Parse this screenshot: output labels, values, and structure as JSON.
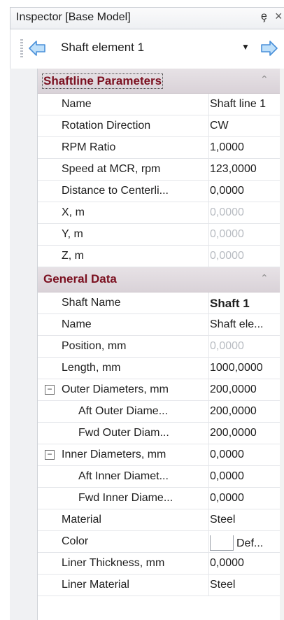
{
  "window": {
    "title": "Inspector [Base Model]",
    "pin_glyph": "ȩ",
    "close_glyph": "×"
  },
  "selector": {
    "label": "Shaft element 1",
    "arrow_glyph": "▼"
  },
  "icons": {
    "nav_left": "arrow-left-icon",
    "nav_right": "arrow-right-icon",
    "accent": "#5aa7e6",
    "category_text": "#7b1020"
  },
  "categories": {
    "shaftline": {
      "label": "Shaftline Parameters",
      "collapse_glyph": "⌃",
      "rows": [
        {
          "name": "Name",
          "value": "Shaft line 1"
        },
        {
          "name": "Rotation Direction",
          "value": "CW"
        },
        {
          "name": "RPM Ratio",
          "value": "1,0000"
        },
        {
          "name": "Speed at MCR, rpm",
          "value": "123,0000"
        },
        {
          "name": "Distance to Centerli...",
          "value": "0,0000"
        },
        {
          "name": "X, m",
          "value": "0,0000"
        },
        {
          "name": "Y, m",
          "value": "0,0000"
        },
        {
          "name": "Z, m",
          "value": "0,0000"
        }
      ]
    },
    "general": {
      "label": "General Data",
      "collapse_glyph": "⌃",
      "rows": [
        {
          "name": "Shaft Name",
          "value": "Shaft 1"
        },
        {
          "name": "Name",
          "value": "Shaft ele..."
        },
        {
          "name": "Position, mm",
          "value": "0,0000"
        },
        {
          "name": "Length, mm",
          "value": "1000,0000"
        },
        {
          "name": "Outer Diameters, mm",
          "value": "200,0000",
          "expander": "−"
        },
        {
          "name": "Aft Outer Diame...",
          "value": "200,0000"
        },
        {
          "name": "Fwd Outer Diam...",
          "value": "200,0000"
        },
        {
          "name": "Inner Diameters, mm",
          "value": "0,0000",
          "expander": "−"
        },
        {
          "name": "Aft Inner Diamet...",
          "value": "0,0000"
        },
        {
          "name": "Fwd Inner Diame...",
          "value": "0,0000"
        },
        {
          "name": "Material",
          "value": "Steel"
        },
        {
          "name": "Color",
          "value": "Def..."
        },
        {
          "name": "Liner Thickness, mm",
          "value": "0,0000"
        },
        {
          "name": "Liner Material",
          "value": "Steel"
        }
      ]
    }
  }
}
